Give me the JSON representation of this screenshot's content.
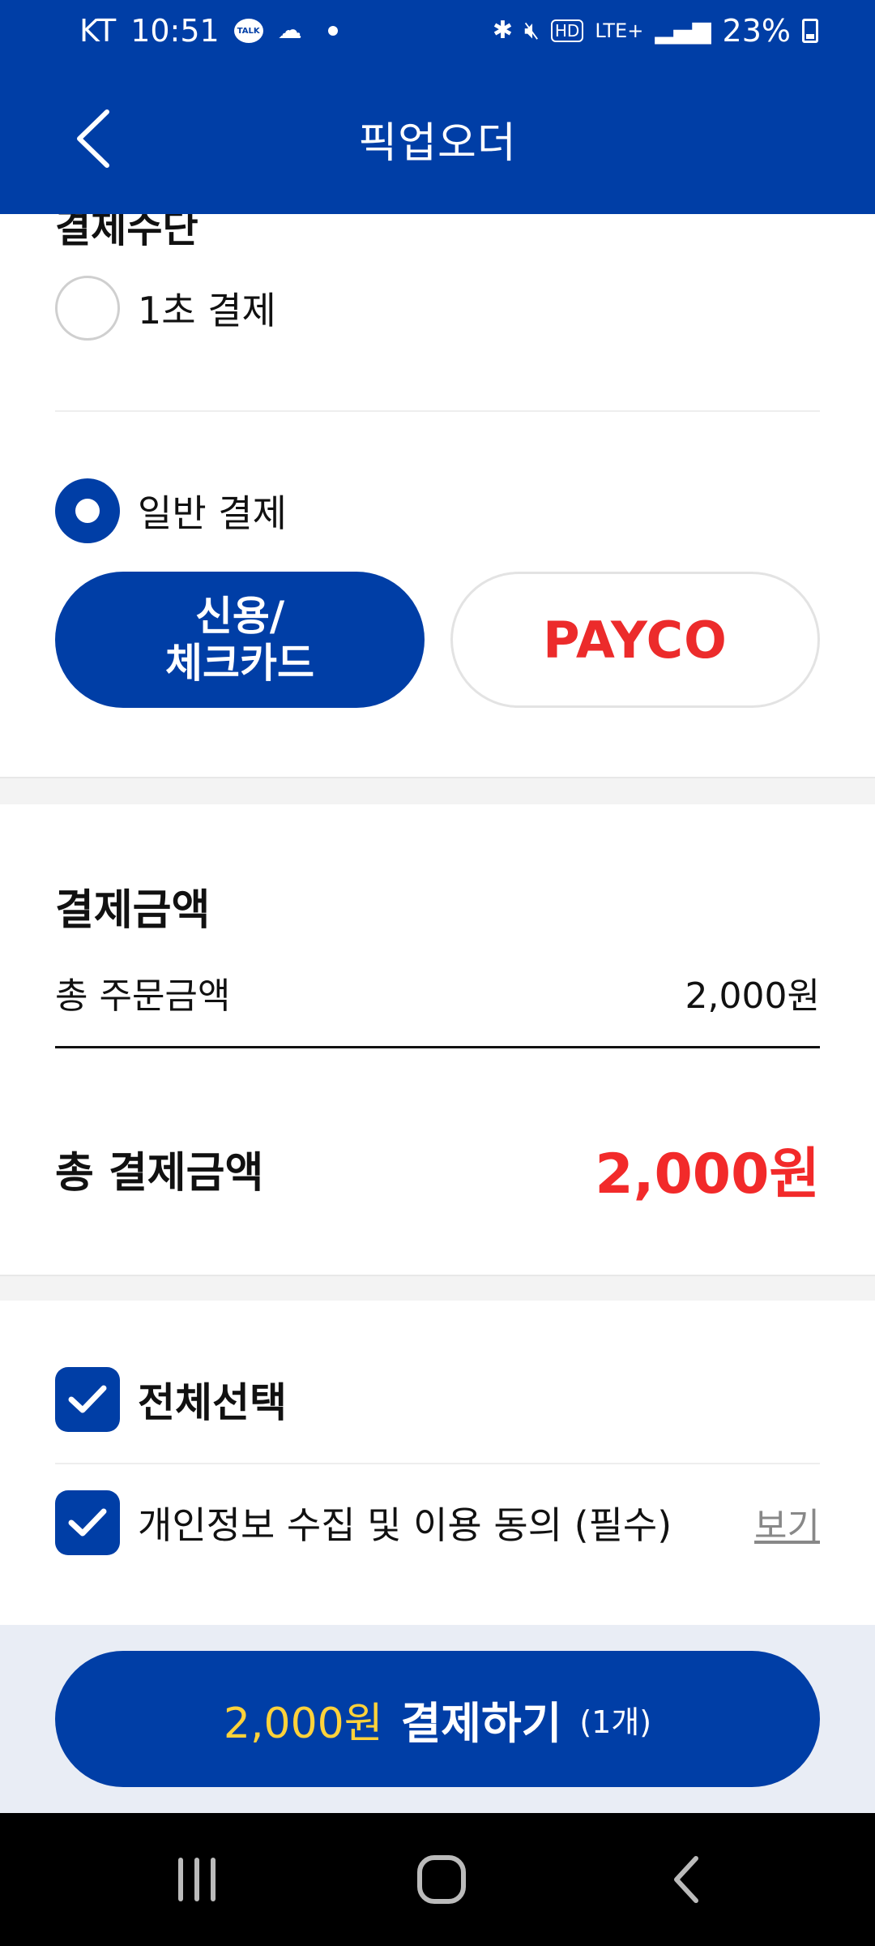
{
  "status_bar": {
    "carrier": "KT",
    "time": "10:51",
    "talk_badge": "TALK",
    "network": "LTE+",
    "battery": "23%"
  },
  "header": {
    "title": "픽업오더"
  },
  "payment_method": {
    "section_title": "결제수단",
    "one_second_pay": "1초 결제",
    "general_pay": "일반 결제",
    "card_line1": "신용/",
    "card_line2": "체크카드",
    "payco": "PAYCO"
  },
  "amount": {
    "section_title": "결제금액",
    "order_total_label": "총 주문금액",
    "order_total_value": "2,000원",
    "pay_total_label": "총 결제금액",
    "pay_total_value": "2,000원"
  },
  "agreement": {
    "select_all": "전체선택",
    "privacy_consent": "개인정보 수집 및 이용 동의 (필수)",
    "view": "보기"
  },
  "pay_button": {
    "amount": "2,000원",
    "label": "결제하기",
    "count": "(1개)"
  },
  "colors": {
    "primary": "#003ea6",
    "price_red": "#f22a2a",
    "highlight_yellow": "#ffd23a",
    "payco_red": "#ec2b2b"
  }
}
